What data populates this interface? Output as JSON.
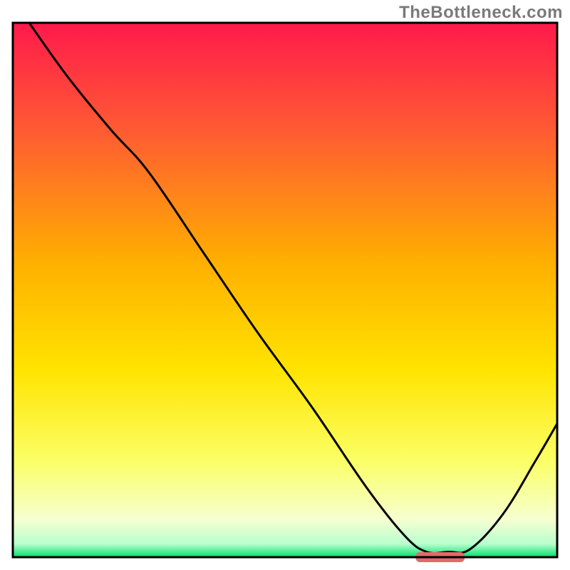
{
  "watermark": "TheBottleneck.com",
  "chart_data": {
    "type": "line",
    "title": "",
    "xlabel": "",
    "ylabel": "",
    "xlim": [
      0,
      100
    ],
    "ylim": [
      0,
      100
    ],
    "grid": false,
    "legend": false,
    "description": "Bottleneck curve over a red-to-green vertical gradient. The black curve starts at the top-left (≈100%), descends steeply with a slight knee near x≈25, reaches a flat minimum near zero around x≈75–82, then rises toward the right edge. A short red/pink horizontal marker sits on the x-axis under the flat minimum.",
    "gradient_stops": [
      {
        "offset": 0.0,
        "color": "#ff1a4b"
      },
      {
        "offset": 0.2,
        "color": "#ff5a33"
      },
      {
        "offset": 0.45,
        "color": "#ffb000"
      },
      {
        "offset": 0.65,
        "color": "#ffe400"
      },
      {
        "offset": 0.82,
        "color": "#fbff66"
      },
      {
        "offset": 0.93,
        "color": "#f6ffd0"
      },
      {
        "offset": 0.975,
        "color": "#b9ffcf"
      },
      {
        "offset": 1.0,
        "color": "#00e06a"
      }
    ],
    "series": [
      {
        "name": "bottleneck-curve",
        "x": [
          3,
          10,
          18,
          25,
          35,
          45,
          55,
          65,
          72,
          76,
          80,
          84,
          90,
          96,
          100
        ],
        "y": [
          100,
          90,
          80,
          72,
          57,
          42,
          28,
          13,
          4,
          1,
          1,
          1.5,
          8,
          18,
          25
        ]
      }
    ],
    "marker": {
      "x_start": 74,
      "x_end": 83,
      "y": 0,
      "color": "#e26a6a",
      "thickness_px": 14
    },
    "frame": {
      "stroke": "#000000",
      "stroke_width": 3
    }
  }
}
